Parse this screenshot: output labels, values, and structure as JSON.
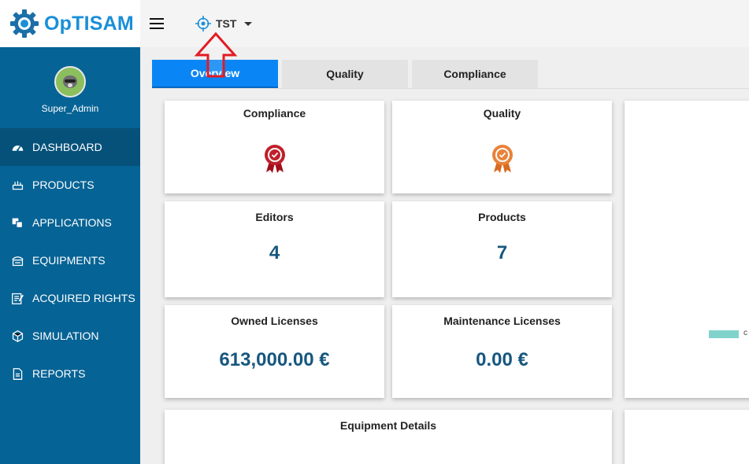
{
  "app": {
    "name": "OpTISAM",
    "brand_color": "#1a8fd8",
    "sidebar_color": "#066395"
  },
  "user": {
    "name": "Super_Admin"
  },
  "nav": [
    {
      "label": "DASHBOARD",
      "icon": "dashboard-icon"
    },
    {
      "label": "PRODUCTS",
      "icon": "products-icon"
    },
    {
      "label": "APPLICATIONS",
      "icon": "applications-icon"
    },
    {
      "label": "EQUIPMENTS",
      "icon": "equipments-icon"
    },
    {
      "label": "ACQUIRED RIGHTS",
      "icon": "acquired-rights-icon"
    },
    {
      "label": "SIMULATION",
      "icon": "simulation-icon"
    },
    {
      "label": "REPORTS",
      "icon": "reports-icon"
    }
  ],
  "topbar": {
    "scope": "TST"
  },
  "tabs": [
    {
      "label": "Overview"
    },
    {
      "label": "Quality"
    },
    {
      "label": "Compliance"
    }
  ],
  "cards": {
    "compliance": {
      "title": "Compliance",
      "icon": "ribbon-badge-icon",
      "color": "#c0202b"
    },
    "quality": {
      "title": "Quality",
      "icon": "ribbon-badge-icon",
      "color": "#e9823a"
    },
    "editors": {
      "title": "Editors",
      "value": "4"
    },
    "products": {
      "title": "Products",
      "value": "7"
    },
    "owned_licenses": {
      "title": "Owned Licenses",
      "value": "613,000.00 €"
    },
    "maintenance_licenses": {
      "title": "Maintenance Licenses",
      "value": "0.00 €"
    },
    "equipment_details": {
      "title": "Equipment Details"
    }
  },
  "legend": {
    "label": "c",
    "color": "#80d3cb"
  }
}
